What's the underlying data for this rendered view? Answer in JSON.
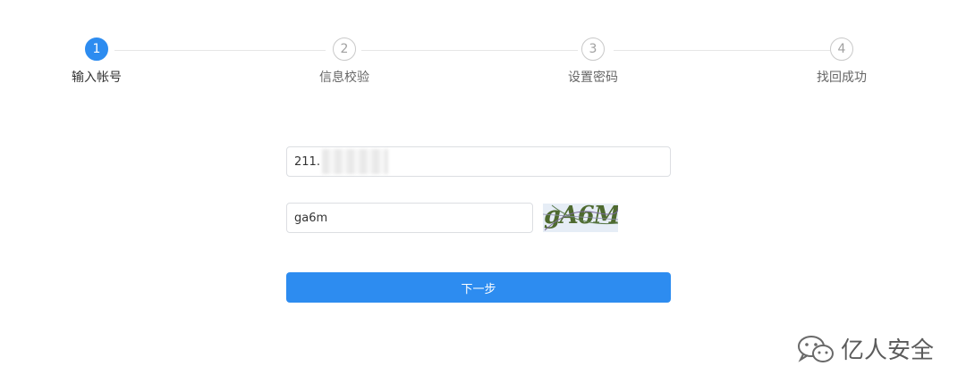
{
  "steps": [
    {
      "number": "1",
      "label": "输入帐号",
      "active": true
    },
    {
      "number": "2",
      "label": "信息校验",
      "active": false
    },
    {
      "number": "3",
      "label": "设置密码",
      "active": false
    },
    {
      "number": "4",
      "label": "找回成功",
      "active": false
    }
  ],
  "form": {
    "account_value": "211.",
    "captcha_value": "ga6m",
    "captcha_image_text": "gA6M",
    "next_label": "下一步"
  },
  "watermark": {
    "text": "亿人安全",
    "icon": "wechat-icon"
  },
  "colors": {
    "primary": "#2d8cf0",
    "border": "#dcdee2",
    "inactive": "#c9c9c9"
  }
}
